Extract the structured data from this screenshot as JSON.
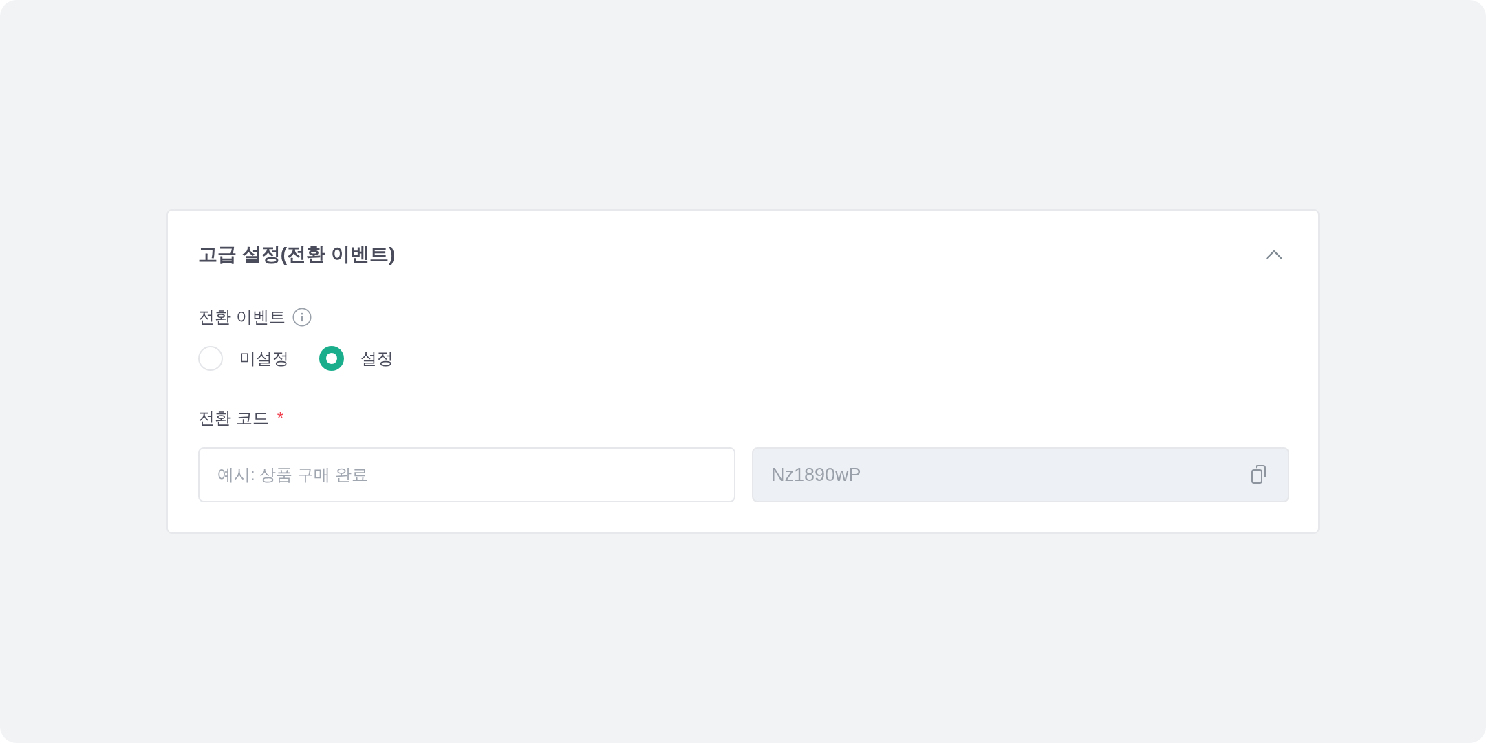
{
  "panel": {
    "title": "고급 설정(전환 이벤트)",
    "expanded": true
  },
  "event_field": {
    "label": "전환 이벤트",
    "options": [
      {
        "label": "미설정",
        "selected": false
      },
      {
        "label": "설정",
        "selected": true
      }
    ]
  },
  "code_field": {
    "label": "전환 코드",
    "required_mark": "*",
    "name_input": {
      "placeholder": "예시: 상품 구매 완료"
    },
    "code_input": {
      "value": "Nz1890wP",
      "disabled": true
    }
  }
}
